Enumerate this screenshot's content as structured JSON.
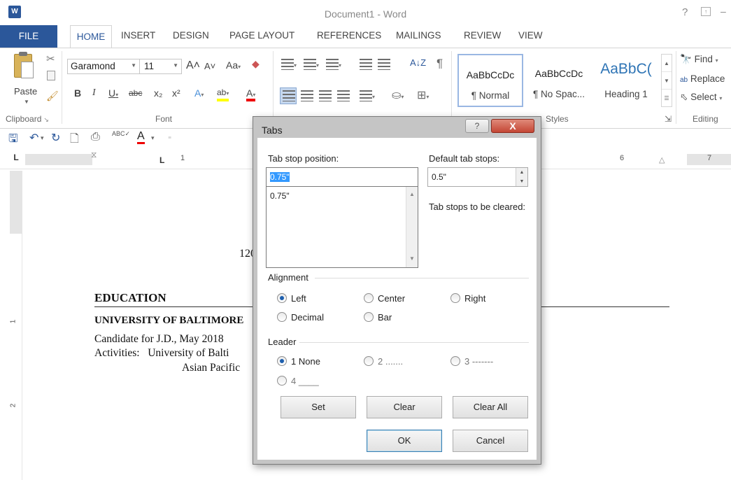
{
  "window": {
    "app_icon_letter": "W",
    "title": "Document1 - Word",
    "help": "?",
    "ribbon_options": "↑",
    "minimize": "–"
  },
  "tabs": {
    "file": "FILE",
    "home": "HOME",
    "insert": "INSERT",
    "design": "DESIGN",
    "page_layout": "PAGE LAYOUT",
    "references": "REFERENCES",
    "mailings": "MAILINGS",
    "review": "REVIEW",
    "view": "VIEW"
  },
  "ribbon": {
    "clipboard": {
      "paste": "Paste",
      "group": "Clipboard",
      "launcher": "↘"
    },
    "font": {
      "name": "Garamond",
      "size": "11",
      "grow": "A˄",
      "shrink": "A˅",
      "change_case": "Aa",
      "bold": "B",
      "italic": "I",
      "underline": "U",
      "strike": "abc",
      "subscript": "x₂",
      "superscript": "x²",
      "text_effects": "A",
      "highlight": "ab",
      "font_color": "A",
      "group": "Font"
    },
    "paragraph": {
      "show_marks": "¶",
      "sort": "A↓Z"
    },
    "styles": {
      "normal_sample": "AaBbCcDc",
      "normal_name": "¶ Normal",
      "nospacing_sample": "AaBbCcDc",
      "nospacing_name": "¶ No Spac...",
      "heading1_sample": "AaBbC(",
      "heading1_name": "Heading 1",
      "group": "Styles"
    },
    "editing": {
      "find": "Find",
      "replace": "Replace",
      "select": "Select",
      "group": "Editing"
    }
  },
  "ruler": {
    "selector": "L",
    "n1": "1",
    "n6": "6",
    "n7": "7",
    "v1": "1",
    "v2": "2"
  },
  "document": {
    "partial_line": "120",
    "education": "EDUCATION",
    "university": "UNIVERSITY OF BALTIMORE",
    "candidate": "Candidate for J.D., May 2018",
    "activities": "Activities:   University of Balti",
    "asian": "Asian Pacific"
  },
  "dialog": {
    "title": "Tabs",
    "help": "?",
    "close": "X",
    "tab_stop_label": "Tab stop position:",
    "tab_stop_value": "0.75\"",
    "tab_stop_list": [
      "0.75\""
    ],
    "default_label": "Default tab stops:",
    "default_value": "0.5\"",
    "cleared_label": "Tab stops to be cleared:",
    "alignment_label": "Alignment",
    "alignment": {
      "left": "Left",
      "center": "Center",
      "right": "Right",
      "decimal": "Decimal",
      "bar": "Bar"
    },
    "leader_label": "Leader",
    "leader": {
      "none": "1 None",
      "dots": "2 .......",
      "dashes": "3 -------",
      "line": "4 ____"
    },
    "buttons": {
      "set": "Set",
      "clear": "Clear",
      "clear_all": "Clear All",
      "ok": "OK",
      "cancel": "Cancel"
    }
  }
}
